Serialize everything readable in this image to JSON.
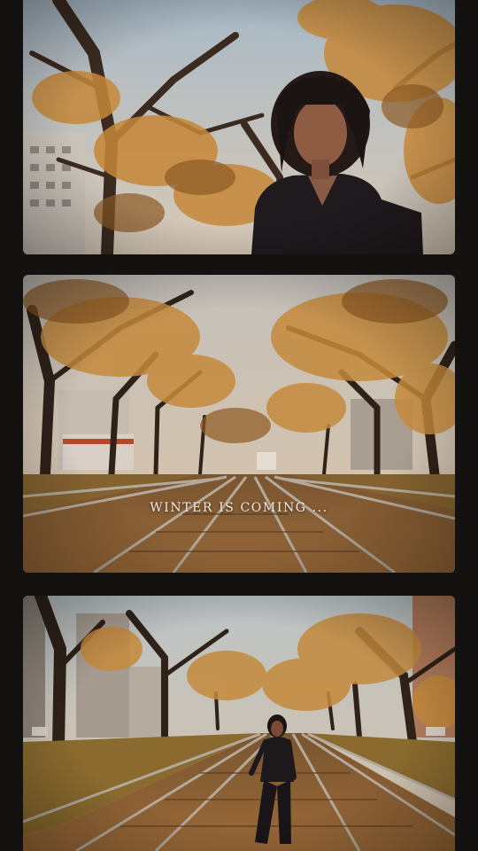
{
  "caption": {
    "text": "WINTER IS COMING ..."
  },
  "palette": {
    "background": "#141111",
    "sky": "#b9c6cf",
    "foliage": "#c98a3a",
    "ground": "#8a5a2e",
    "rail": "#a39a8e",
    "caption_color": "#f3ece2"
  },
  "frames": [
    {
      "subject": "woman-portrait"
    },
    {
      "subject": "tram-tracks-avenue"
    },
    {
      "subject": "woman-walking-on-tracks"
    }
  ]
}
